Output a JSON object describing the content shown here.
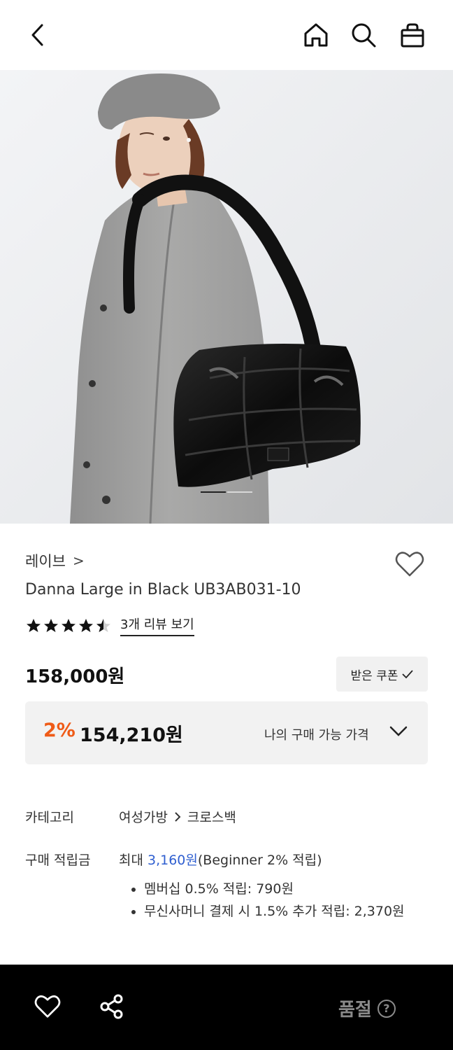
{
  "header": {
    "back_icon": "chevron-left-icon",
    "home_icon": "home-icon",
    "search_icon": "search-icon",
    "cart_icon": "shopping-bag-icon"
  },
  "product": {
    "image_alt": "",
    "image_dots": {
      "count": 2,
      "active": 0
    },
    "brand": "레이브",
    "brand_chevron": ">",
    "name": "Danna Large in Black UB3AB031-10",
    "rating": 4.5,
    "review_link": "3개 리뷰 보기",
    "price": "158,000원",
    "coupon_label": "받은 쿠폰",
    "my_price": {
      "discount": "2%",
      "amount": "154,210원",
      "label": "나의 구매 가능 가격"
    }
  },
  "details": {
    "category_label": "카테고리",
    "category_path": [
      "여성가방",
      "크로스백"
    ],
    "points_label": "구매 적립금",
    "points_prefix": "최대 ",
    "points_value": "3,160원",
    "points_suffix": "(Beginner 2% 적립)",
    "bullets": [
      "멤버십 0.5% 적립: 790원",
      "무신사머니 결제 시 1.5% 추가 적립: 2,370원"
    ]
  },
  "bottom_bar": {
    "wish_icon": "heart-icon",
    "share_icon": "share-icon",
    "status_label": "품절",
    "help_icon": "?"
  },
  "colors": {
    "discount": "#ef5b17",
    "link_blue": "#2f5fd0",
    "bottom_bar_bg": "#000000",
    "sold_out_text": "#8a8a8a"
  }
}
